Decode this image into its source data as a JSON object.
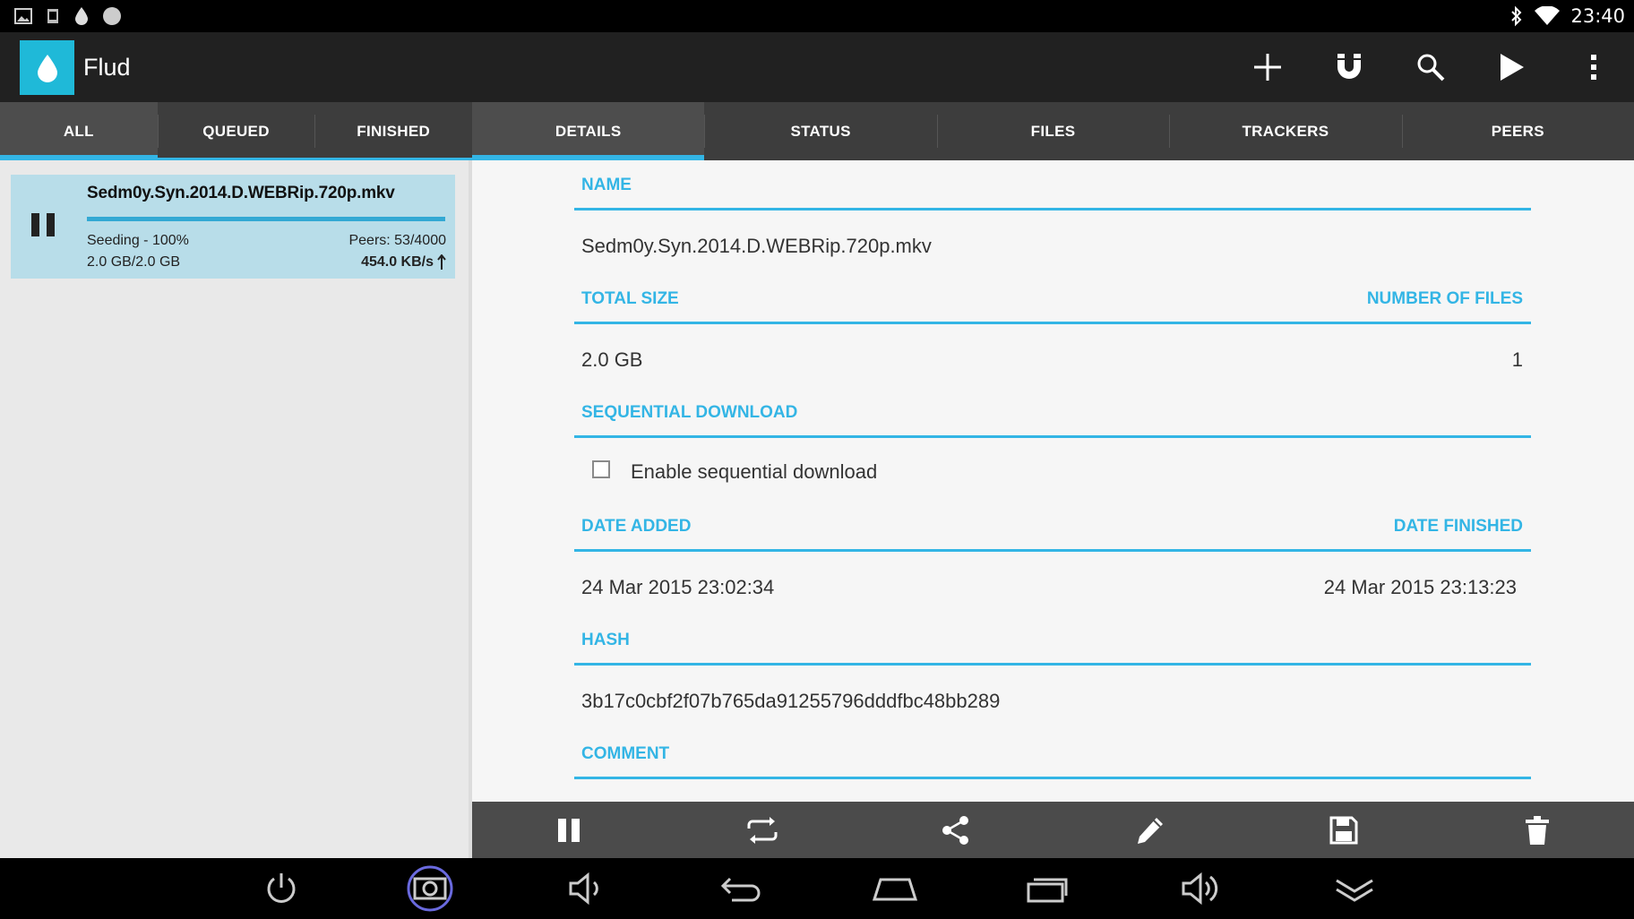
{
  "status_bar": {
    "time": "23:40",
    "left_icons": [
      "image-icon",
      "screenshot-icon",
      "flud-drop-icon",
      "circle-icon"
    ],
    "right_icons": [
      "bluetooth-icon",
      "wifi-icon"
    ]
  },
  "app": {
    "title": "Flud",
    "logo_color": "#1fb9d8",
    "accent_color": "#33b5e5",
    "actions": [
      "add-icon",
      "magnet-icon",
      "search-icon",
      "play-icon",
      "overflow-menu-icon"
    ]
  },
  "list_tabs": [
    {
      "label": "ALL",
      "active": true
    },
    {
      "label": "QUEUED",
      "active": false
    },
    {
      "label": "FINISHED",
      "active": false
    }
  ],
  "detail_tabs": [
    {
      "label": "DETAILS",
      "active": true
    },
    {
      "label": "STATUS",
      "active": false
    },
    {
      "label": "FILES",
      "active": false
    },
    {
      "label": "TRACKERS",
      "active": false
    },
    {
      "label": "PEERS",
      "active": false
    }
  ],
  "torrent": {
    "name": "Sedm0y.Syn.2014.D.WEBRip.720p.mkv",
    "status": "Seeding - 100%",
    "progress_percent": 100,
    "size": "2.0 GB/2.0 GB",
    "peers": "Peers: 53/4000",
    "speed": "454.0 KB/s"
  },
  "details": {
    "name_label": "NAME",
    "name_value": "Sedm0y.Syn.2014.D.WEBRip.720p.mkv",
    "total_size_label": "TOTAL SIZE",
    "total_size_value": "2.0 GB",
    "num_files_label": "NUMBER OF FILES",
    "num_files_value": "1",
    "sequential_label": "SEQUENTIAL DOWNLOAD",
    "sequential_checkbox_label": "Enable sequential download",
    "sequential_checked": false,
    "date_added_label": "DATE ADDED",
    "date_added_value": "24 Mar 2015 23:02:34",
    "date_finished_label": "DATE FINISHED",
    "date_finished_value": "24 Mar 2015 23:13:23",
    "hash_label": "HASH",
    "hash_value": "3b17c0cbf2f07b765da91255796dddfbc48bb289",
    "comment_label": "COMMENT"
  },
  "toolbar": [
    "pause-icon",
    "recheck-icon",
    "share-icon",
    "edit-icon",
    "save-icon",
    "delete-icon"
  ],
  "nav_bar": [
    "power-icon",
    "screenshot-icon",
    "volume-down-icon",
    "back-icon",
    "home-icon",
    "recents-icon",
    "volume-up-icon",
    "hide-bar-icon"
  ]
}
